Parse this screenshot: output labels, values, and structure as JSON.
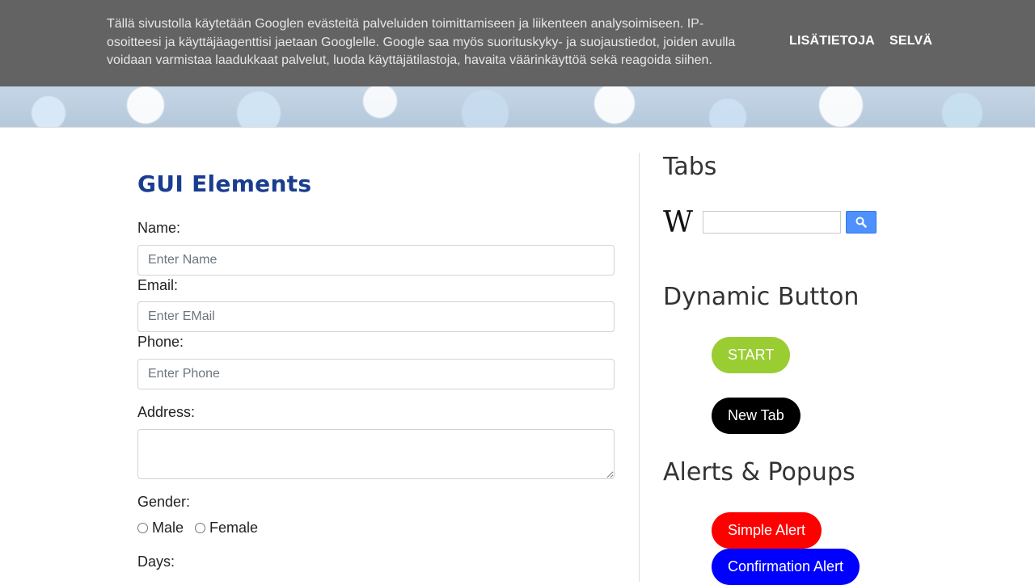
{
  "cookie": {
    "text": "Tällä sivustolla käytetään Googlen evästeitä palveluiden toimittamiseen ja liikenteen analysoimiseen. IP-osoitteesi ja käyttäjäagenttisi jaetaan Googlelle. Google saa myös suorituskyky- ja suojaustiedot, joiden avulla voidaan varmistaa laadukkaat palvelut, luoda käyttäjätilastoja, havaita väärinkäyttöä sekä reagoida siihen.",
    "more_label": "LISÄTIETOJA",
    "ok_label": "SELVÄ"
  },
  "form": {
    "title": "GUI Elements",
    "name_label": "Name:",
    "name_placeholder": "Enter Name",
    "email_label": "Email:",
    "email_placeholder": "Enter EMail",
    "phone_label": "Phone:",
    "phone_placeholder": "Enter Phone",
    "address_label": "Address:",
    "gender_label": "Gender:",
    "gender_options": [
      "Male",
      "Female"
    ],
    "days_label": "Days:"
  },
  "sidebar": {
    "tabs_heading": "Tabs",
    "wiki_logo": "W",
    "dynamic_heading": "Dynamic Button",
    "start_label": "START",
    "newtab_label": "New Tab",
    "alerts_heading": "Alerts & Popups",
    "simple_alert_label": "Simple Alert",
    "confirm_alert_label": "Confirmation Alert"
  },
  "colors": {
    "title": "#1a3d8f",
    "start": "#9acd32",
    "newtab": "#000000",
    "simple_alert": "#ff0000",
    "confirm_alert": "#0000ff",
    "cookie_bg": "#636363"
  }
}
